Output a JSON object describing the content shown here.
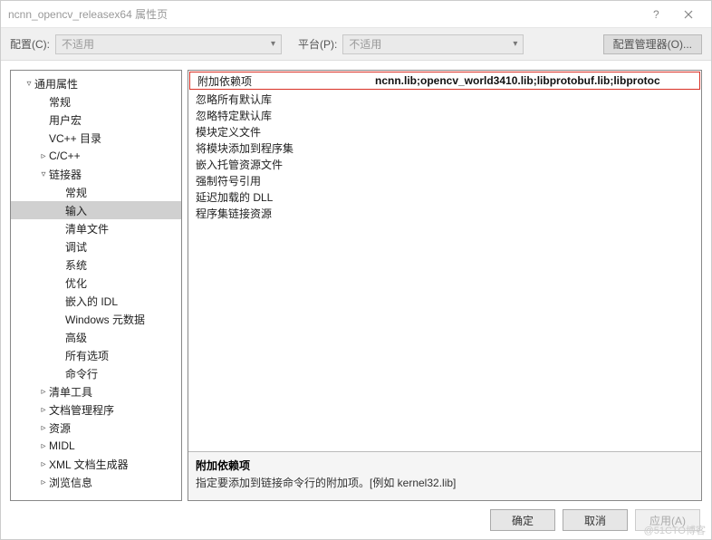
{
  "titlebar": {
    "title": "ncnn_opencv_releasex64 属性页"
  },
  "toolbar": {
    "config_label": "配置(C):",
    "config_value": "不适用",
    "platform_label": "平台(P):",
    "platform_value": "不适用",
    "config_manager": "配置管理器(O)..."
  },
  "tree": [
    {
      "level": 1,
      "twisty": "▿",
      "label": "通用属性",
      "name": "tree-common-properties"
    },
    {
      "level": 2,
      "twisty": "",
      "label": "常规",
      "name": "tree-general"
    },
    {
      "level": 2,
      "twisty": "",
      "label": "用户宏",
      "name": "tree-user-macros"
    },
    {
      "level": 2,
      "twisty": "",
      "label": "VC++ 目录",
      "name": "tree-vcpp-dirs"
    },
    {
      "level": 2,
      "twisty": "▹",
      "label": "C/C++",
      "name": "tree-c-cpp"
    },
    {
      "level": 2,
      "twisty": "▿",
      "label": "链接器",
      "name": "tree-linker"
    },
    {
      "level": 3,
      "twisty": "",
      "label": "常规",
      "name": "tree-linker-general"
    },
    {
      "level": 3,
      "twisty": "",
      "label": "输入",
      "name": "tree-linker-input",
      "selected": true
    },
    {
      "level": 3,
      "twisty": "",
      "label": "清单文件",
      "name": "tree-linker-manifest"
    },
    {
      "level": 3,
      "twisty": "",
      "label": "调试",
      "name": "tree-linker-debug"
    },
    {
      "level": 3,
      "twisty": "",
      "label": "系统",
      "name": "tree-linker-system"
    },
    {
      "level": 3,
      "twisty": "",
      "label": "优化",
      "name": "tree-linker-optimize"
    },
    {
      "level": 3,
      "twisty": "",
      "label": "嵌入的 IDL",
      "name": "tree-linker-embedded-idl"
    },
    {
      "level": 3,
      "twisty": "",
      "label": "Windows 元数据",
      "name": "tree-linker-winmd"
    },
    {
      "level": 3,
      "twisty": "",
      "label": "高级",
      "name": "tree-linker-advanced"
    },
    {
      "level": 3,
      "twisty": "",
      "label": "所有选项",
      "name": "tree-linker-all"
    },
    {
      "level": 3,
      "twisty": "",
      "label": "命令行",
      "name": "tree-linker-cmdline"
    },
    {
      "level": 2,
      "twisty": "▹",
      "label": "清单工具",
      "name": "tree-manifest-tool"
    },
    {
      "level": 2,
      "twisty": "▹",
      "label": "文档管理程序",
      "name": "tree-librarian"
    },
    {
      "level": 2,
      "twisty": "▹",
      "label": "资源",
      "name": "tree-resources"
    },
    {
      "level": 2,
      "twisty": "▹",
      "label": "MIDL",
      "name": "tree-midl"
    },
    {
      "level": 2,
      "twisty": "▹",
      "label": "XML 文档生成器",
      "name": "tree-xml-doc"
    },
    {
      "level": 2,
      "twisty": "▹",
      "label": "浏览信息",
      "name": "tree-browse-info"
    }
  ],
  "grid": [
    {
      "label": "附加依赖项",
      "value": "ncnn.lib;opencv_world3410.lib;libprotobuf.lib;libprotoc",
      "highlight": true,
      "name": "row-additional-dependencies"
    },
    {
      "label": "忽略所有默认库",
      "value": "",
      "name": "row-ignore-all-default-libs"
    },
    {
      "label": "忽略特定默认库",
      "value": "",
      "name": "row-ignore-specific-default-libs"
    },
    {
      "label": "模块定义文件",
      "value": "",
      "name": "row-module-definition-file"
    },
    {
      "label": "将模块添加到程序集",
      "value": "",
      "name": "row-add-module-to-assembly"
    },
    {
      "label": "嵌入托管资源文件",
      "value": "",
      "name": "row-embed-managed-resource"
    },
    {
      "label": "强制符号引用",
      "value": "",
      "name": "row-force-symbol-references"
    },
    {
      "label": "延迟加载的 DLL",
      "value": "",
      "name": "row-delay-loaded-dlls"
    },
    {
      "label": "程序集链接资源",
      "value": "",
      "name": "row-assembly-link-resource"
    }
  ],
  "description": {
    "title": "附加依赖项",
    "text": "指定要添加到链接命令行的附加项。[例如 kernel32.lib]"
  },
  "footer": {
    "ok": "确定",
    "cancel": "取消",
    "apply": "应用(A)"
  },
  "watermark": "@51CTO博客"
}
